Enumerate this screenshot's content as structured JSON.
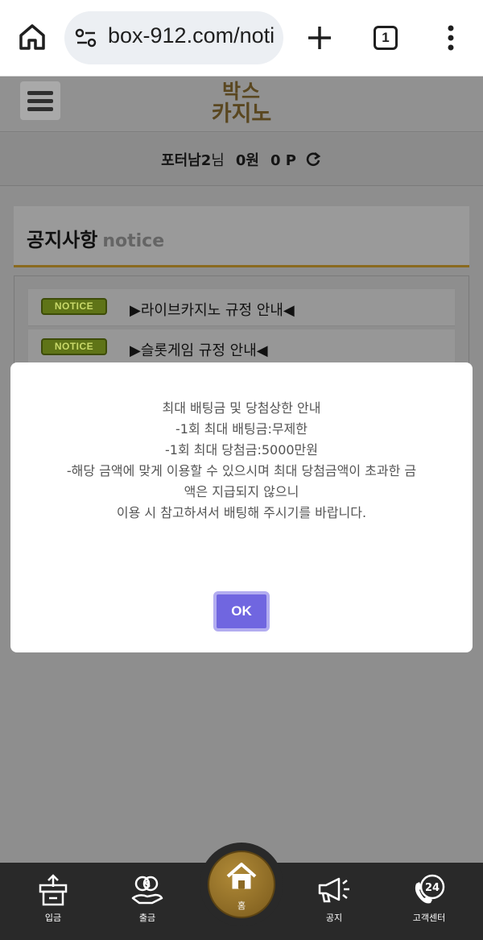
{
  "browser": {
    "url": "box-912.com/noti",
    "tab_count": "1"
  },
  "site": {
    "logo_line1": "박스",
    "logo_line2": "카지노"
  },
  "user": {
    "name": "포터남2",
    "honorific": "님",
    "balance": "0원",
    "points": "0 P"
  },
  "notice": {
    "title": "공지사항",
    "subtitle": "notice",
    "items": [
      {
        "badge": "NOTICE",
        "text": "▶라이브카지노 규정 안내◀"
      },
      {
        "badge": "NOTICE",
        "text": "▶슬롯게임 규정 안내◀"
      }
    ]
  },
  "modal": {
    "lines": [
      "최대 배팅금 및 당첨상한 안내",
      "-1회 최대 배팅금:무제한",
      "-1회 최대 당첨금:5000만원",
      "-해당 금액에 맞게 이용할 수 있으시며 최대 당첨금액이 초과한 금",
      "액은 지급되지 않으니",
      "이용 시 참고하셔서 배팅해 주시기를 바랍니다."
    ],
    "ok_label": "OK"
  },
  "bottom_nav": {
    "deposit": "입금",
    "withdraw": "출금",
    "home": "홈",
    "notice": "공지",
    "support": "고객센터"
  },
  "colors": {
    "modal_button": "#7066e0",
    "notice_underline": "#8a6a1f",
    "badge": "#5f7417",
    "nav_bg": "#292929"
  }
}
